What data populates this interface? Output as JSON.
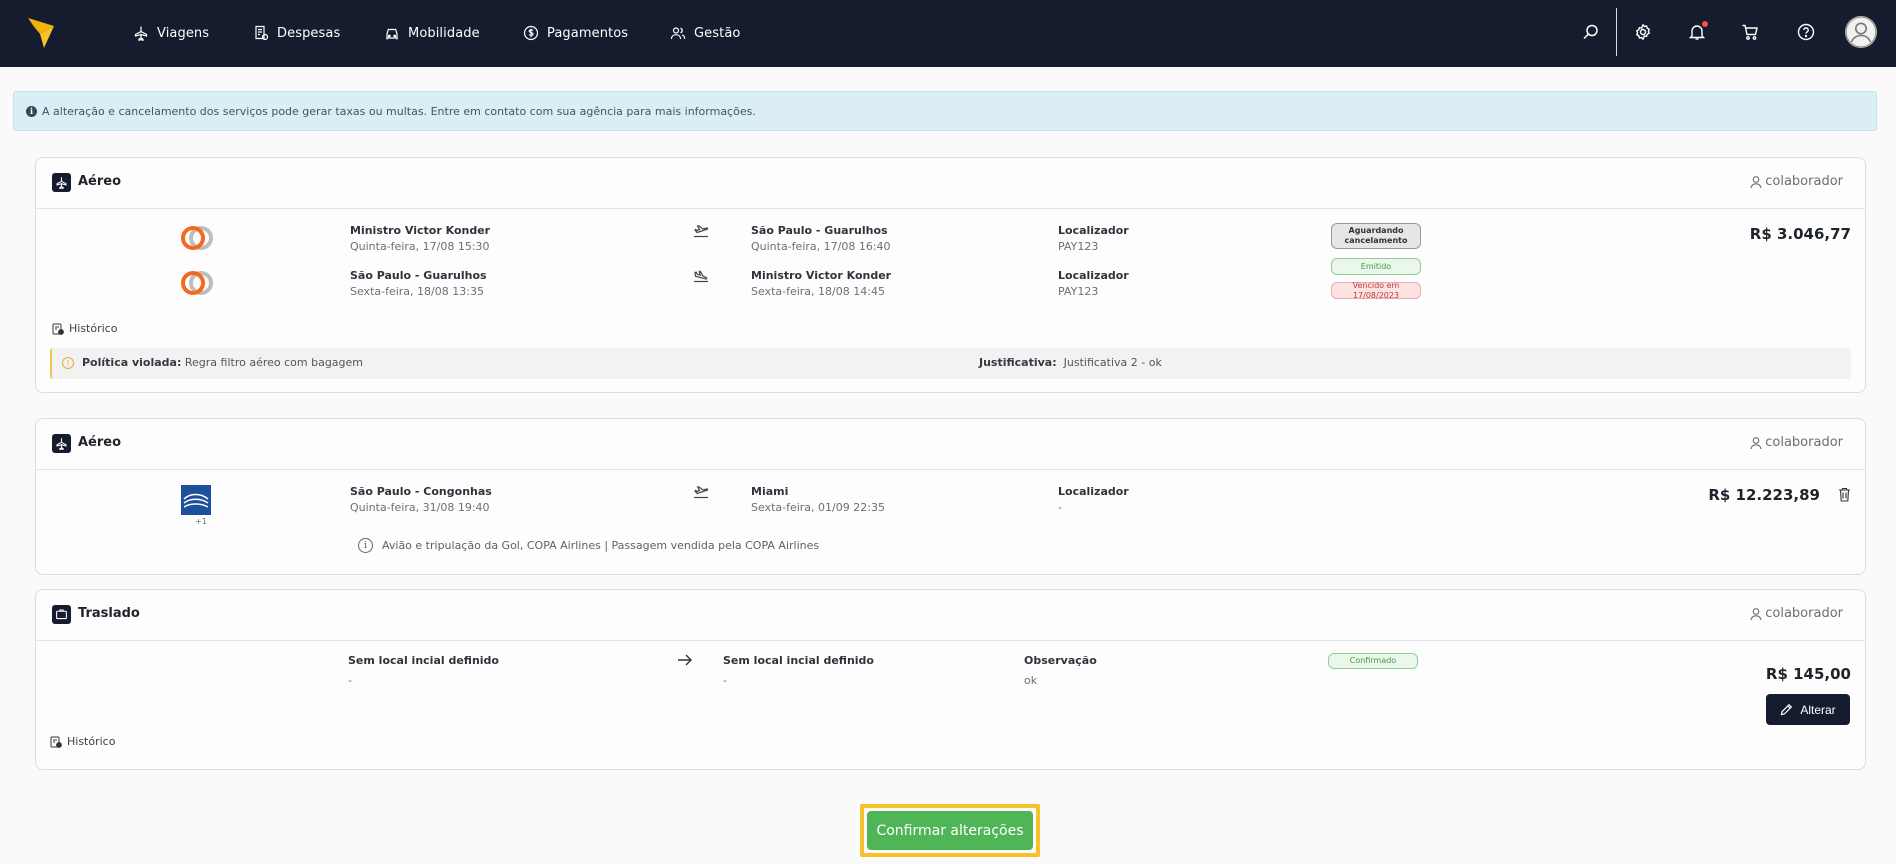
{
  "nav": {
    "items": [
      {
        "label": "Viagens",
        "icon": "plane-icon"
      },
      {
        "label": "Despesas",
        "icon": "receipt-icon"
      },
      {
        "label": "Mobilidade",
        "icon": "car-icon"
      },
      {
        "label": "Pagamentos",
        "icon": "dollar-icon"
      },
      {
        "label": "Gestão",
        "icon": "users-icon"
      }
    ]
  },
  "alert": {
    "text": "A alteração e cancelamento dos serviços pode gerar taxas ou multas. Entre em contato com sua agência para mais informações."
  },
  "cards": [
    {
      "type": "Aéreo",
      "user": "colaborador",
      "legs": [
        {
          "origin": "Ministro Victor Konder",
          "origin_date": "Quinta-feira, 17/08 15:30",
          "destination": "São Paulo - Guarulhos",
          "destination_date": "Quinta-feira, 17/08 16:40",
          "locator_label": "Localizador",
          "locator": "PAY123"
        },
        {
          "origin": "São Paulo - Guarulhos",
          "origin_date": "Sexta-feira, 18/08 13:35",
          "destination": "Ministro Victor Konder",
          "destination_date": "Sexta-feira, 18/08 14:45",
          "locator_label": "Localizador",
          "locator": "PAY123"
        }
      ],
      "badges": [
        "Aguardando cancelamento",
        "Emitido",
        "Vencido em 17/08/2023"
      ],
      "price": "R$ 3.046,77",
      "history": "Histórico",
      "policy_label": "Política violada:",
      "policy_text": "Regra filtro aéreo com bagagem",
      "justification_label": "Justificativa:",
      "justification_text": "Justificativa 2 - ok"
    },
    {
      "type": "Aéreo",
      "user": "colaborador",
      "origin": "São Paulo - Congonhas",
      "origin_date": "Quinta-feira, 31/08 19:40",
      "destination": "Miami",
      "destination_date": "Sexta-feira, 01/09 22:35",
      "locator_label": "Localizador",
      "locator": "-",
      "extra": "+1",
      "price": "R$ 12.223,89",
      "info": "Avião e tripulação da Gol, COPA Airlines | Passagem vendida pela COPA Airlines"
    },
    {
      "type": "Traslado",
      "user": "colaborador",
      "origin": "Sem local incial definido",
      "origin_value": "-",
      "destination": "Sem local incial definido",
      "destination_value": "-",
      "observation_label": "Observação",
      "observation": "ok",
      "badge": "Confirmado",
      "price": "R$ 145,00",
      "edit_button": "Alterar",
      "history": "Histórico"
    }
  ],
  "confirm_button": "Confirmar alterações",
  "colors": {
    "navbar": "#141c2e",
    "confirm": "#4fb556",
    "highlight": "#f7c12a"
  }
}
